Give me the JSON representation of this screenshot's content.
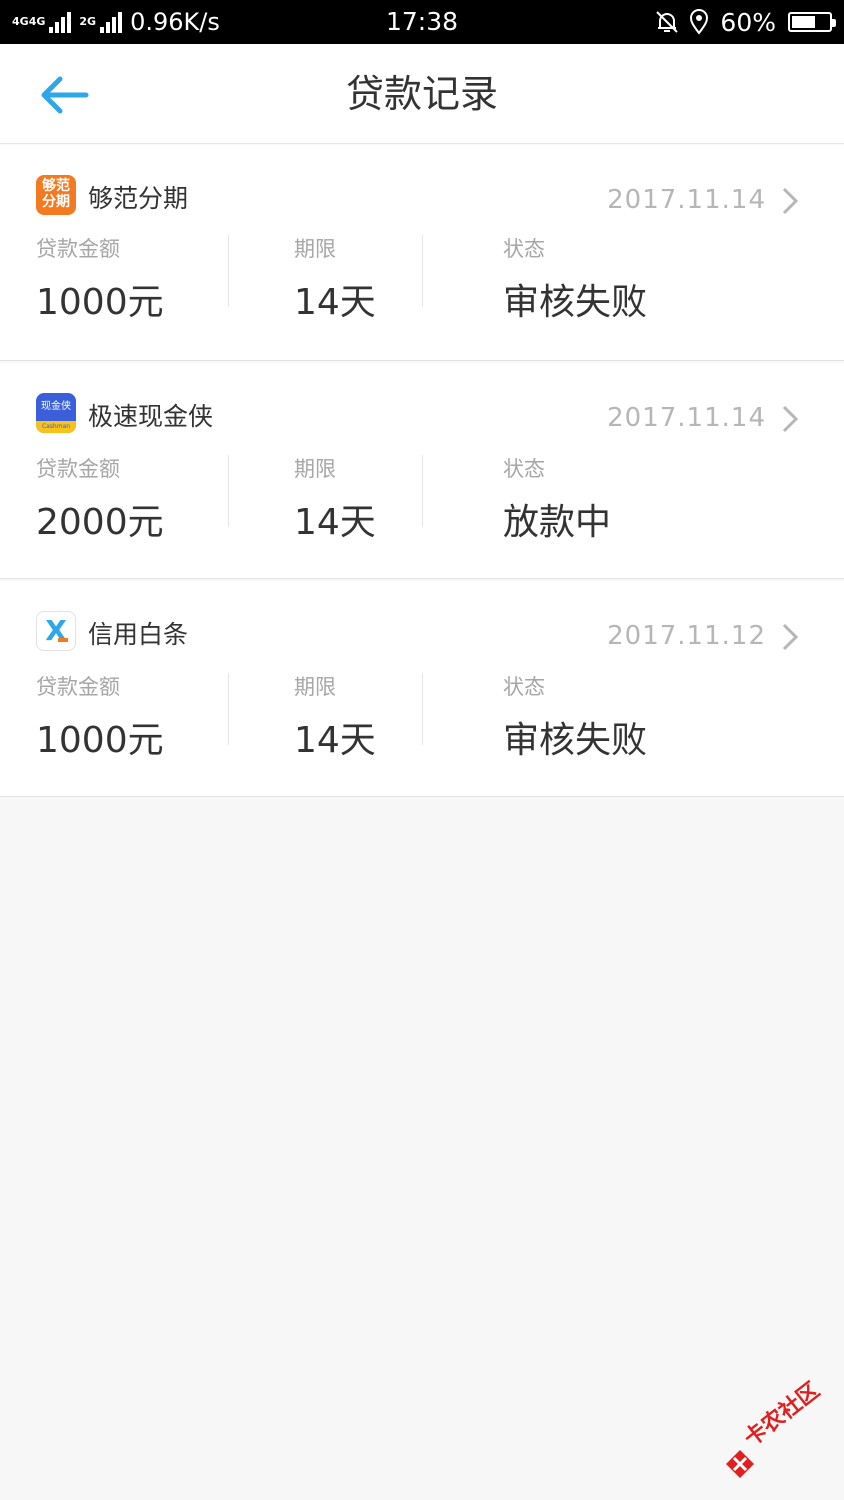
{
  "status_bar": {
    "network_a": "4G",
    "network_b": "4G",
    "network_c": "2G",
    "speed": "0.96K/s",
    "time": "17:38",
    "battery": "60%"
  },
  "header": {
    "title": "贷款记录"
  },
  "records": [
    {
      "app_name": "够范分期",
      "logo_text_top": "够范",
      "logo_text_bottom": "分期",
      "date": "2017.11.14",
      "amount_label": "贷款金额",
      "amount": "1000元",
      "term_label": "期限",
      "term": "14天",
      "status_label": "状态",
      "status": "审核失败"
    },
    {
      "app_name": "极速现金侠",
      "logo_text_top": "现金侠",
      "logo_text_bottom": "Cashman",
      "date": "2017.11.14",
      "amount_label": "贷款金额",
      "amount": "2000元",
      "term_label": "期限",
      "term": "14天",
      "status_label": "状态",
      "status": "放款中"
    },
    {
      "app_name": "信用白条",
      "logo_text_top": "X",
      "date": "2017.11.12",
      "amount_label": "贷款金额",
      "amount": "1000元",
      "term_label": "期限",
      "term": "14天",
      "status_label": "状态",
      "status": "审核失败"
    }
  ],
  "watermark": {
    "text": "卡农社区"
  },
  "colors": {
    "accent": "#2ea7e8",
    "logo_orange": "#f47a21",
    "logo_blue": "#3a5fd8",
    "logo_yellow": "#f8c21c",
    "watermark_red": "#e02020"
  }
}
